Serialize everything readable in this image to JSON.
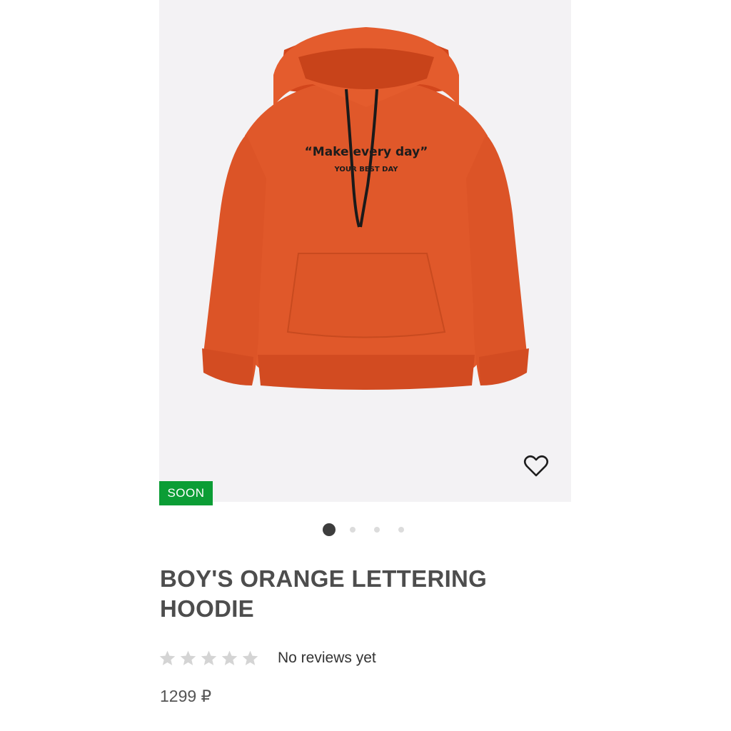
{
  "product": {
    "badge": "SOON",
    "title": "BOY'S ORANGE LETTERING HOODIE",
    "print_line1": "“Make every day”",
    "print_line2": "YOUR BEST DAY",
    "rating": {
      "stars_filled": 0,
      "stars_total": 5,
      "reviews_text": "No reviews yet"
    },
    "price": "1299 ₽"
  },
  "carousel": {
    "slide_count": 4,
    "active_index": 0
  },
  "colors": {
    "badge_bg": "#0b9d35",
    "hoodie": "#e0582a",
    "hoodie_dark": "#c94a20",
    "image_bg": "#f3f2f4",
    "star_empty": "#d4d4d4",
    "title": "#4d4d4d"
  },
  "icons": {
    "wishlist": "heart-outline-icon",
    "rating": "star-icon"
  }
}
